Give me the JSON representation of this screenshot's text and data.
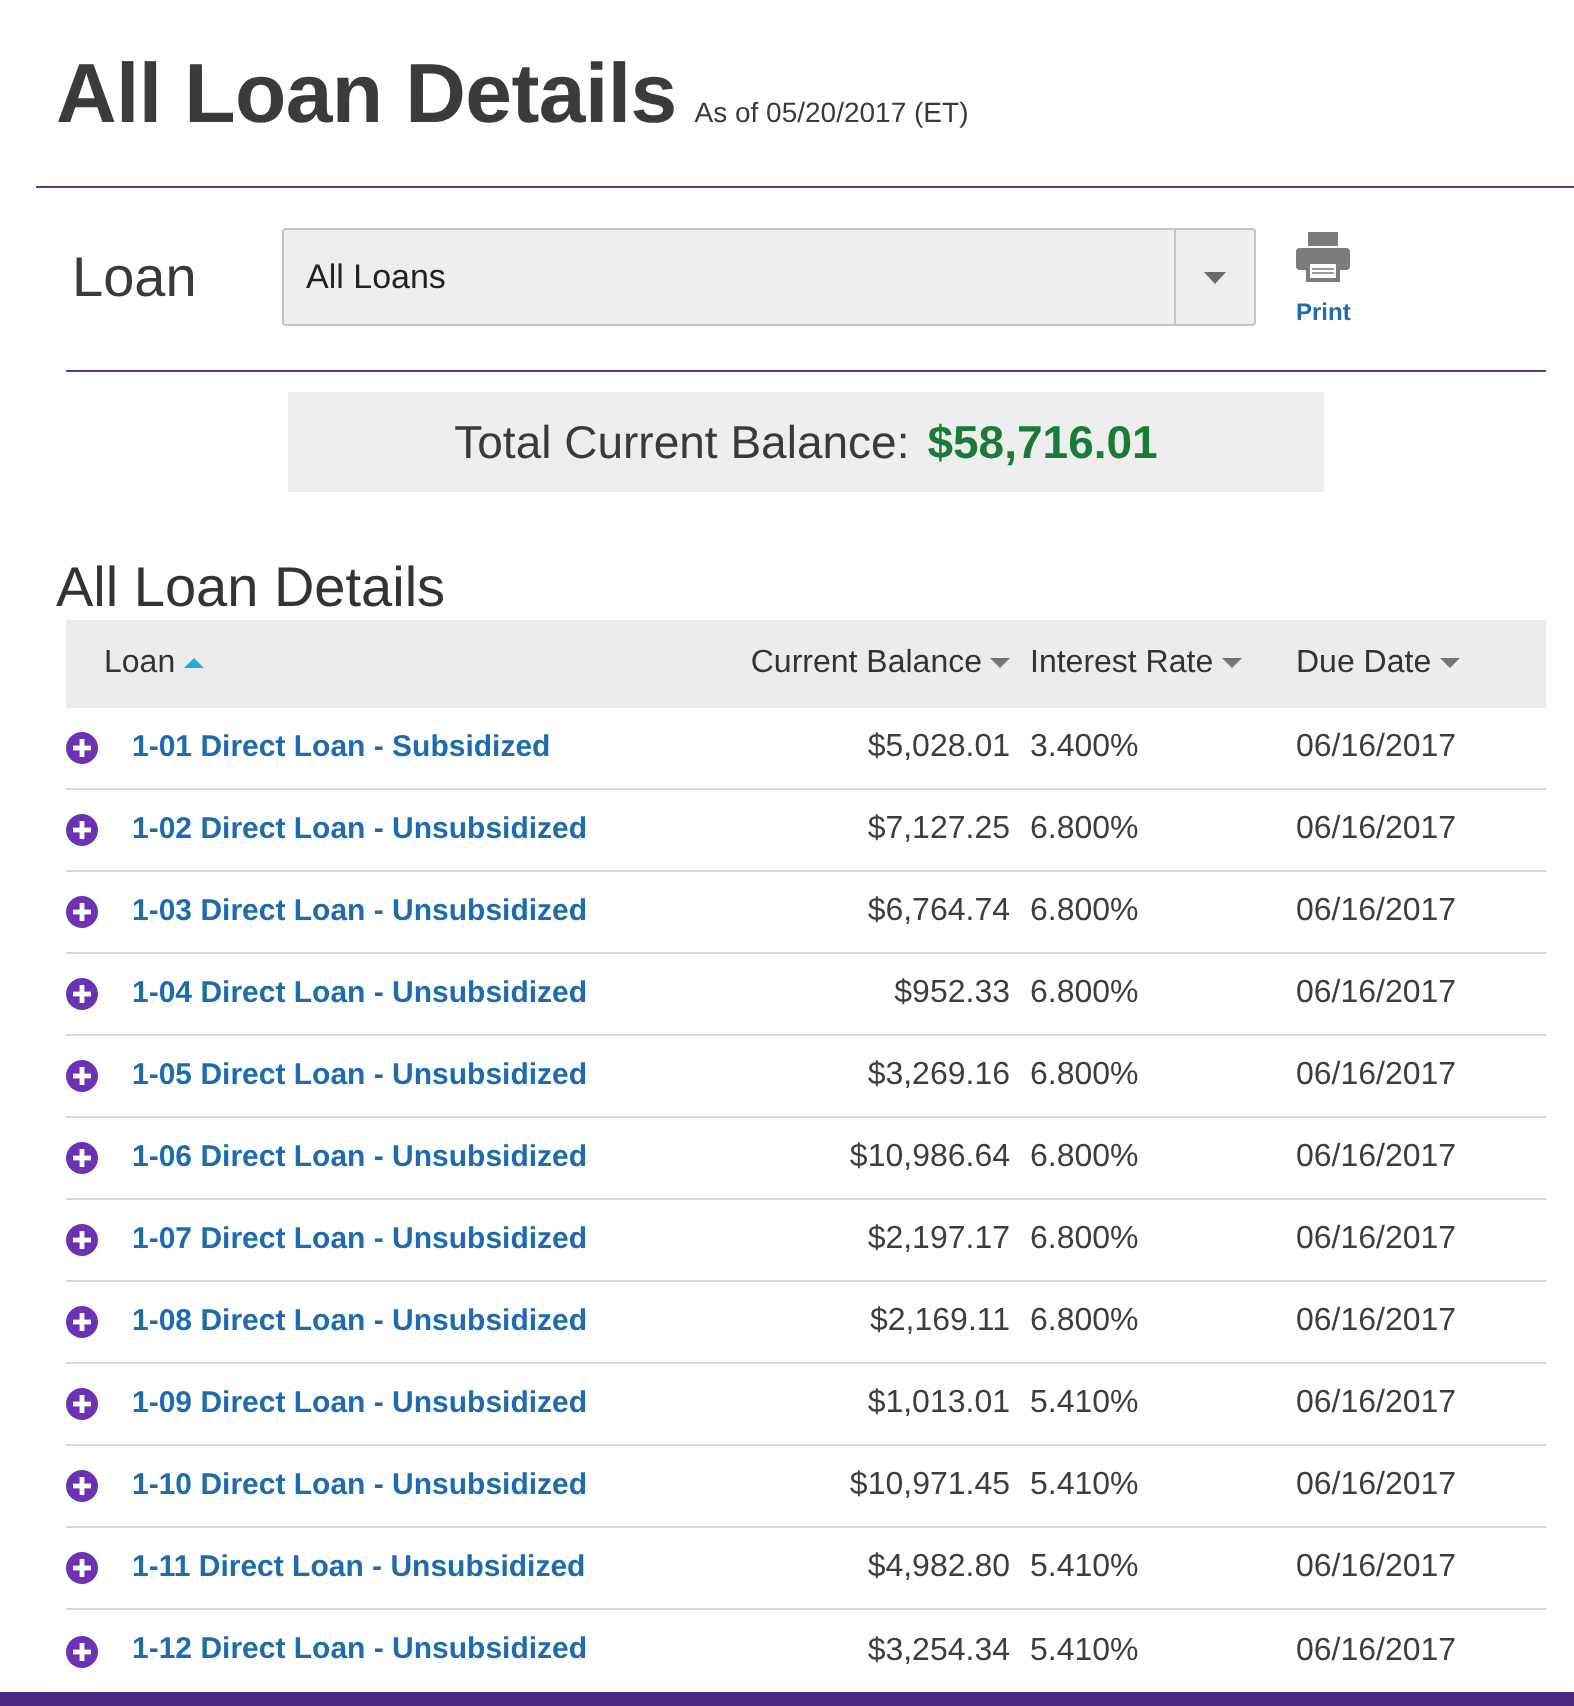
{
  "header": {
    "title": "All Loan Details",
    "as_of": "As of 05/20/2017 (ET)"
  },
  "loan_filter": {
    "label": "Loan",
    "value": "All Loans"
  },
  "print": {
    "label": "Print"
  },
  "total_balance": {
    "label": "Total Current Balance:",
    "value": "$58,716.01"
  },
  "section_title": "All Loan Details",
  "table": {
    "columns": [
      {
        "label": "Loan",
        "selected": true
      },
      {
        "label": "Current Balance",
        "selected": false
      },
      {
        "label": "Interest Rate",
        "selected": false
      },
      {
        "label": "Due Date",
        "selected": false
      }
    ],
    "rows": [
      {
        "loan": "1-01 Direct Loan - Subsidized",
        "current_balance": "$5,028.01",
        "interest_rate": "3.400%",
        "due_date": "06/16/2017",
        "expanded": false
      },
      {
        "loan": "1-02 Direct Loan - Unsubsidized",
        "current_balance": "$7,127.25",
        "interest_rate": "6.800%",
        "due_date": "06/16/2017",
        "expanded": false
      },
      {
        "loan": "1-03 Direct Loan - Unsubsidized",
        "current_balance": "$6,764.74",
        "interest_rate": "6.800%",
        "due_date": "06/16/2017",
        "expanded": false
      },
      {
        "loan": "1-04 Direct Loan - Unsubsidized",
        "current_balance": "$952.33",
        "interest_rate": "6.800%",
        "due_date": "06/16/2017",
        "expanded": false
      },
      {
        "loan": "1-05 Direct Loan - Unsubsidized",
        "current_balance": "$3,269.16",
        "interest_rate": "6.800%",
        "due_date": "06/16/2017",
        "expanded": false
      },
      {
        "loan": "1-06 Direct Loan - Unsubsidized",
        "current_balance": "$10,986.64",
        "interest_rate": "6.800%",
        "due_date": "06/16/2017",
        "expanded": false
      },
      {
        "loan": "1-07 Direct Loan - Unsubsidized",
        "current_balance": "$2,197.17",
        "interest_rate": "6.800%",
        "due_date": "06/16/2017",
        "expanded": false
      },
      {
        "loan": "1-08 Direct Loan - Unsubsidized",
        "current_balance": "$2,169.11",
        "interest_rate": "6.800%",
        "due_date": "06/16/2017",
        "expanded": false
      },
      {
        "loan": "1-09 Direct Loan - Unsubsidized",
        "current_balance": "$1,013.01",
        "interest_rate": "5.410%",
        "due_date": "06/16/2017",
        "expanded": false
      },
      {
        "loan": "1-10 Direct Loan - Unsubsidized",
        "current_balance": "$10,971.45",
        "interest_rate": "5.410%",
        "due_date": "06/16/2017",
        "expanded": false
      },
      {
        "loan": "1-11 Direct Loan - Unsubsidized",
        "current_balance": "$4,982.80",
        "interest_rate": "5.410%",
        "due_date": "06/16/2017",
        "expanded": false
      },
      {
        "loan": "1-12 Direct Loan - Unsubsidized",
        "current_balance": "$3,254.34",
        "interest_rate": "5.410%",
        "due_date": "06/16/2017",
        "expanded": false
      }
    ]
  }
}
